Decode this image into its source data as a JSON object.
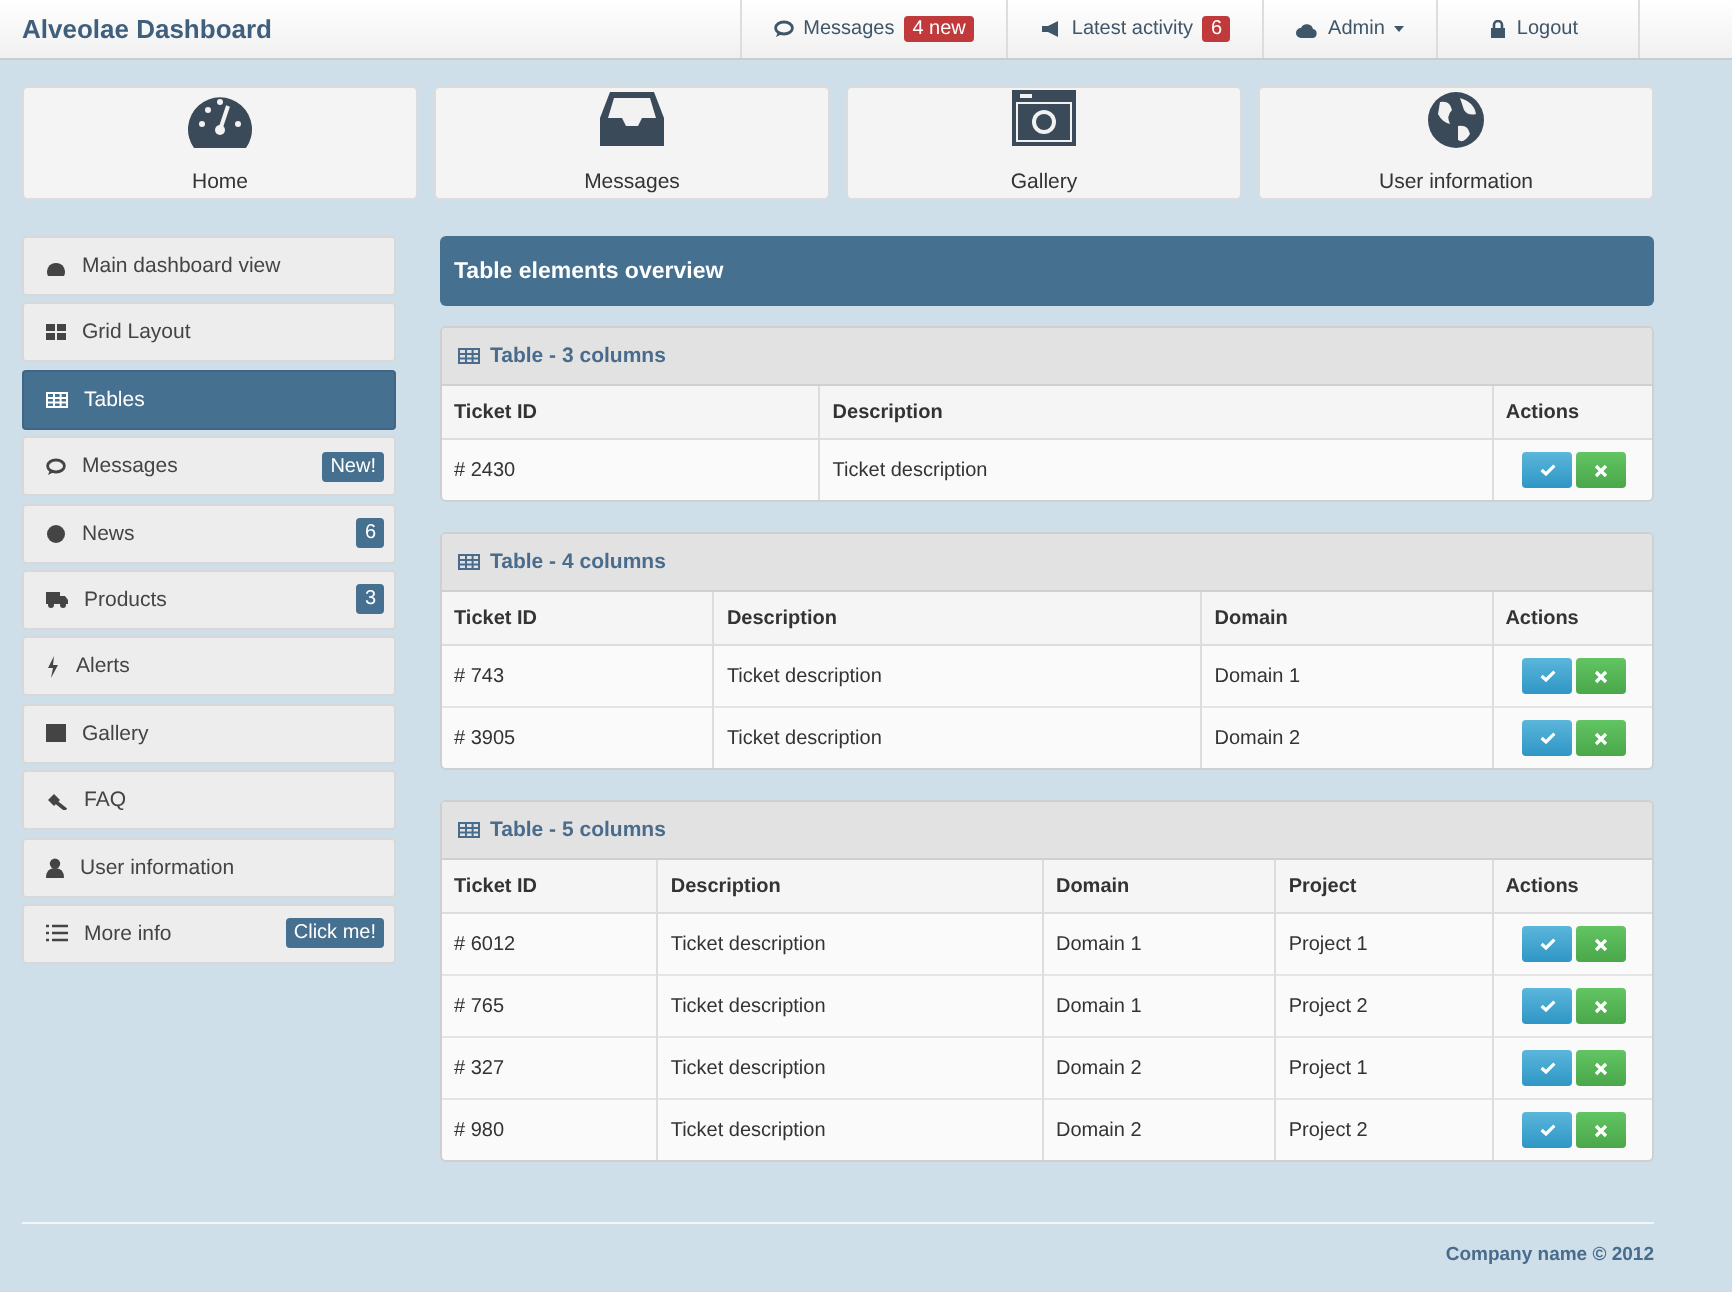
{
  "header": {
    "brand": "Alveolae Dashboard",
    "nav": [
      {
        "kind": "messages",
        "label": "Messages",
        "badge": "4 new"
      },
      {
        "kind": "activity",
        "label": "Latest activity",
        "badge": "6"
      },
      {
        "kind": "admin",
        "label": "Admin",
        "caret": true
      },
      {
        "kind": "logout",
        "label": "Logout"
      }
    ]
  },
  "tiles": [
    {
      "kind": "home",
      "label": "Home"
    },
    {
      "kind": "messages",
      "label": "Messages"
    },
    {
      "kind": "gallery",
      "label": "Gallery"
    },
    {
      "kind": "user",
      "label": "User information"
    }
  ],
  "sidebar": {
    "items": [
      {
        "kind": "dashboard",
        "label": "Main dashboard view",
        "selected": false
      },
      {
        "kind": "grid",
        "label": "Grid Layout",
        "selected": false
      },
      {
        "kind": "tables",
        "label": "Tables",
        "selected": true
      },
      {
        "kind": "messages",
        "label": "Messages",
        "selected": false,
        "badge": "New!"
      },
      {
        "kind": "news",
        "label": "News",
        "selected": false,
        "badge": "6"
      },
      {
        "kind": "products",
        "label": "Products",
        "selected": false,
        "badge": "3"
      },
      {
        "kind": "alerts",
        "label": "Alerts",
        "selected": false
      },
      {
        "kind": "gallery",
        "label": "Gallery",
        "selected": false
      },
      {
        "kind": "faq",
        "label": "FAQ",
        "selected": false
      },
      {
        "kind": "user",
        "label": "User information",
        "selected": false
      },
      {
        "kind": "list",
        "label": "More info",
        "selected": false,
        "badge": "Click me!"
      }
    ]
  },
  "page_title": "Table elements overview",
  "tables": [
    {
      "title": "Table - 3 columns",
      "columns": [
        "Ticket ID",
        "Description",
        "Actions"
      ],
      "rows": [
        [
          "# 2430",
          "Ticket description"
        ]
      ]
    },
    {
      "title": "Table - 4 columns",
      "columns": [
        "Ticket ID",
        "Description",
        "Domain",
        "Actions"
      ],
      "rows": [
        [
          "# 743",
          "Ticket description",
          "Domain 1"
        ],
        [
          "# 3905",
          "Ticket description",
          "Domain 2"
        ]
      ]
    },
    {
      "title": "Table - 5 columns",
      "columns": [
        "Ticket ID",
        "Description",
        "Domain",
        "Project",
        "Actions"
      ],
      "rows": [
        [
          "# 6012",
          "Ticket description",
          "Domain 1",
          "Project 1"
        ],
        [
          "# 765",
          "Ticket description",
          "Domain 1",
          "Project 2"
        ],
        [
          "# 327",
          "Ticket description",
          "Domain 2",
          "Project 1"
        ],
        [
          "# 980",
          "Ticket description",
          "Domain 2",
          "Project 2"
        ]
      ]
    }
  ],
  "footer": "Company name © 2012"
}
